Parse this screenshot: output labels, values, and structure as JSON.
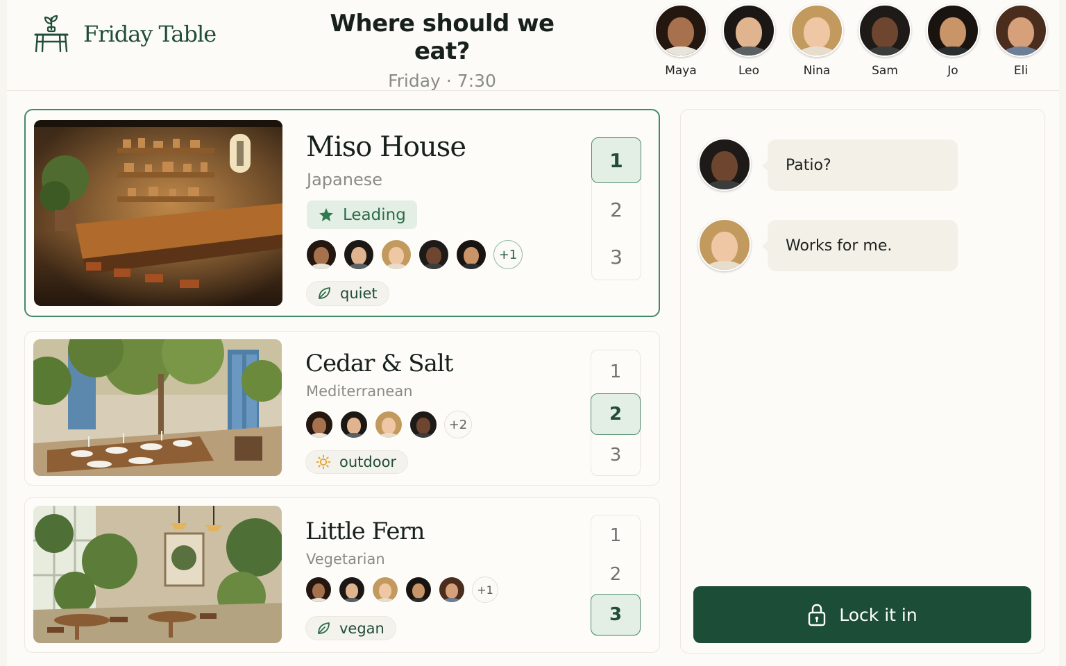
{
  "app": {
    "brand": "Friday Table"
  },
  "header": {
    "title": "Where should we eat?",
    "day": "Friday",
    "separator": "·",
    "time": "7:30"
  },
  "people": [
    {
      "name": "Maya",
      "skin": "#a8714e",
      "hair": "#231710",
      "shirt": "#e9e4da"
    },
    {
      "name": "Leo",
      "skin": "#e0b48e",
      "hair": "#1b1714",
      "shirt": "#5b6063"
    },
    {
      "name": "Nina",
      "skin": "#f0c7a4",
      "hair": "#c39a5d",
      "shirt": "#e7ddcd"
    },
    {
      "name": "Sam",
      "skin": "#6e4630",
      "hair": "#1e1a17",
      "shirt": "#3b3d3c"
    },
    {
      "name": "Jo",
      "skin": "#c99468",
      "hair": "#1a1411",
      "shirt": "#2b2e30"
    },
    {
      "name": "Eli",
      "skin": "#d5a07a",
      "hair": "#4a2d1c",
      "shirt": "#6d7f96"
    }
  ],
  "restaurants": [
    {
      "name": "Miso House",
      "cuisine": "Japanese",
      "status": "Leading",
      "voters_more": "+1",
      "tag": "quiet",
      "tag_icon": "leaf-icon",
      "rank_options": [
        "1",
        "2",
        "3"
      ],
      "selected_rank": "1"
    },
    {
      "name": "Cedar & Salt",
      "cuisine": "Mediterranean",
      "voters_more": "+2",
      "tag": "outdoor",
      "tag_icon": "sun-icon",
      "rank_options": [
        "1",
        "2",
        "3"
      ],
      "selected_rank": "2"
    },
    {
      "name": "Little Fern",
      "cuisine": "Vegetarian",
      "voters_more": "+1",
      "tag": "vegan",
      "tag_icon": "leaf-icon",
      "rank_options": [
        "1",
        "2",
        "3"
      ],
      "selected_rank": "3"
    }
  ],
  "chat": {
    "messages": [
      {
        "author": "Sam",
        "text": "Patio?"
      },
      {
        "author": "Nina",
        "text": "Works for me."
      }
    ],
    "action_label": "Lock it in",
    "action_icon": "lock-icon"
  },
  "colors": {
    "brand_green": "#1f4d36",
    "accent_green": "#3f8a64",
    "selected_fill": "#e3efe5",
    "button_fill": "#1c4d37",
    "page_bg": "#fcfbf7"
  }
}
